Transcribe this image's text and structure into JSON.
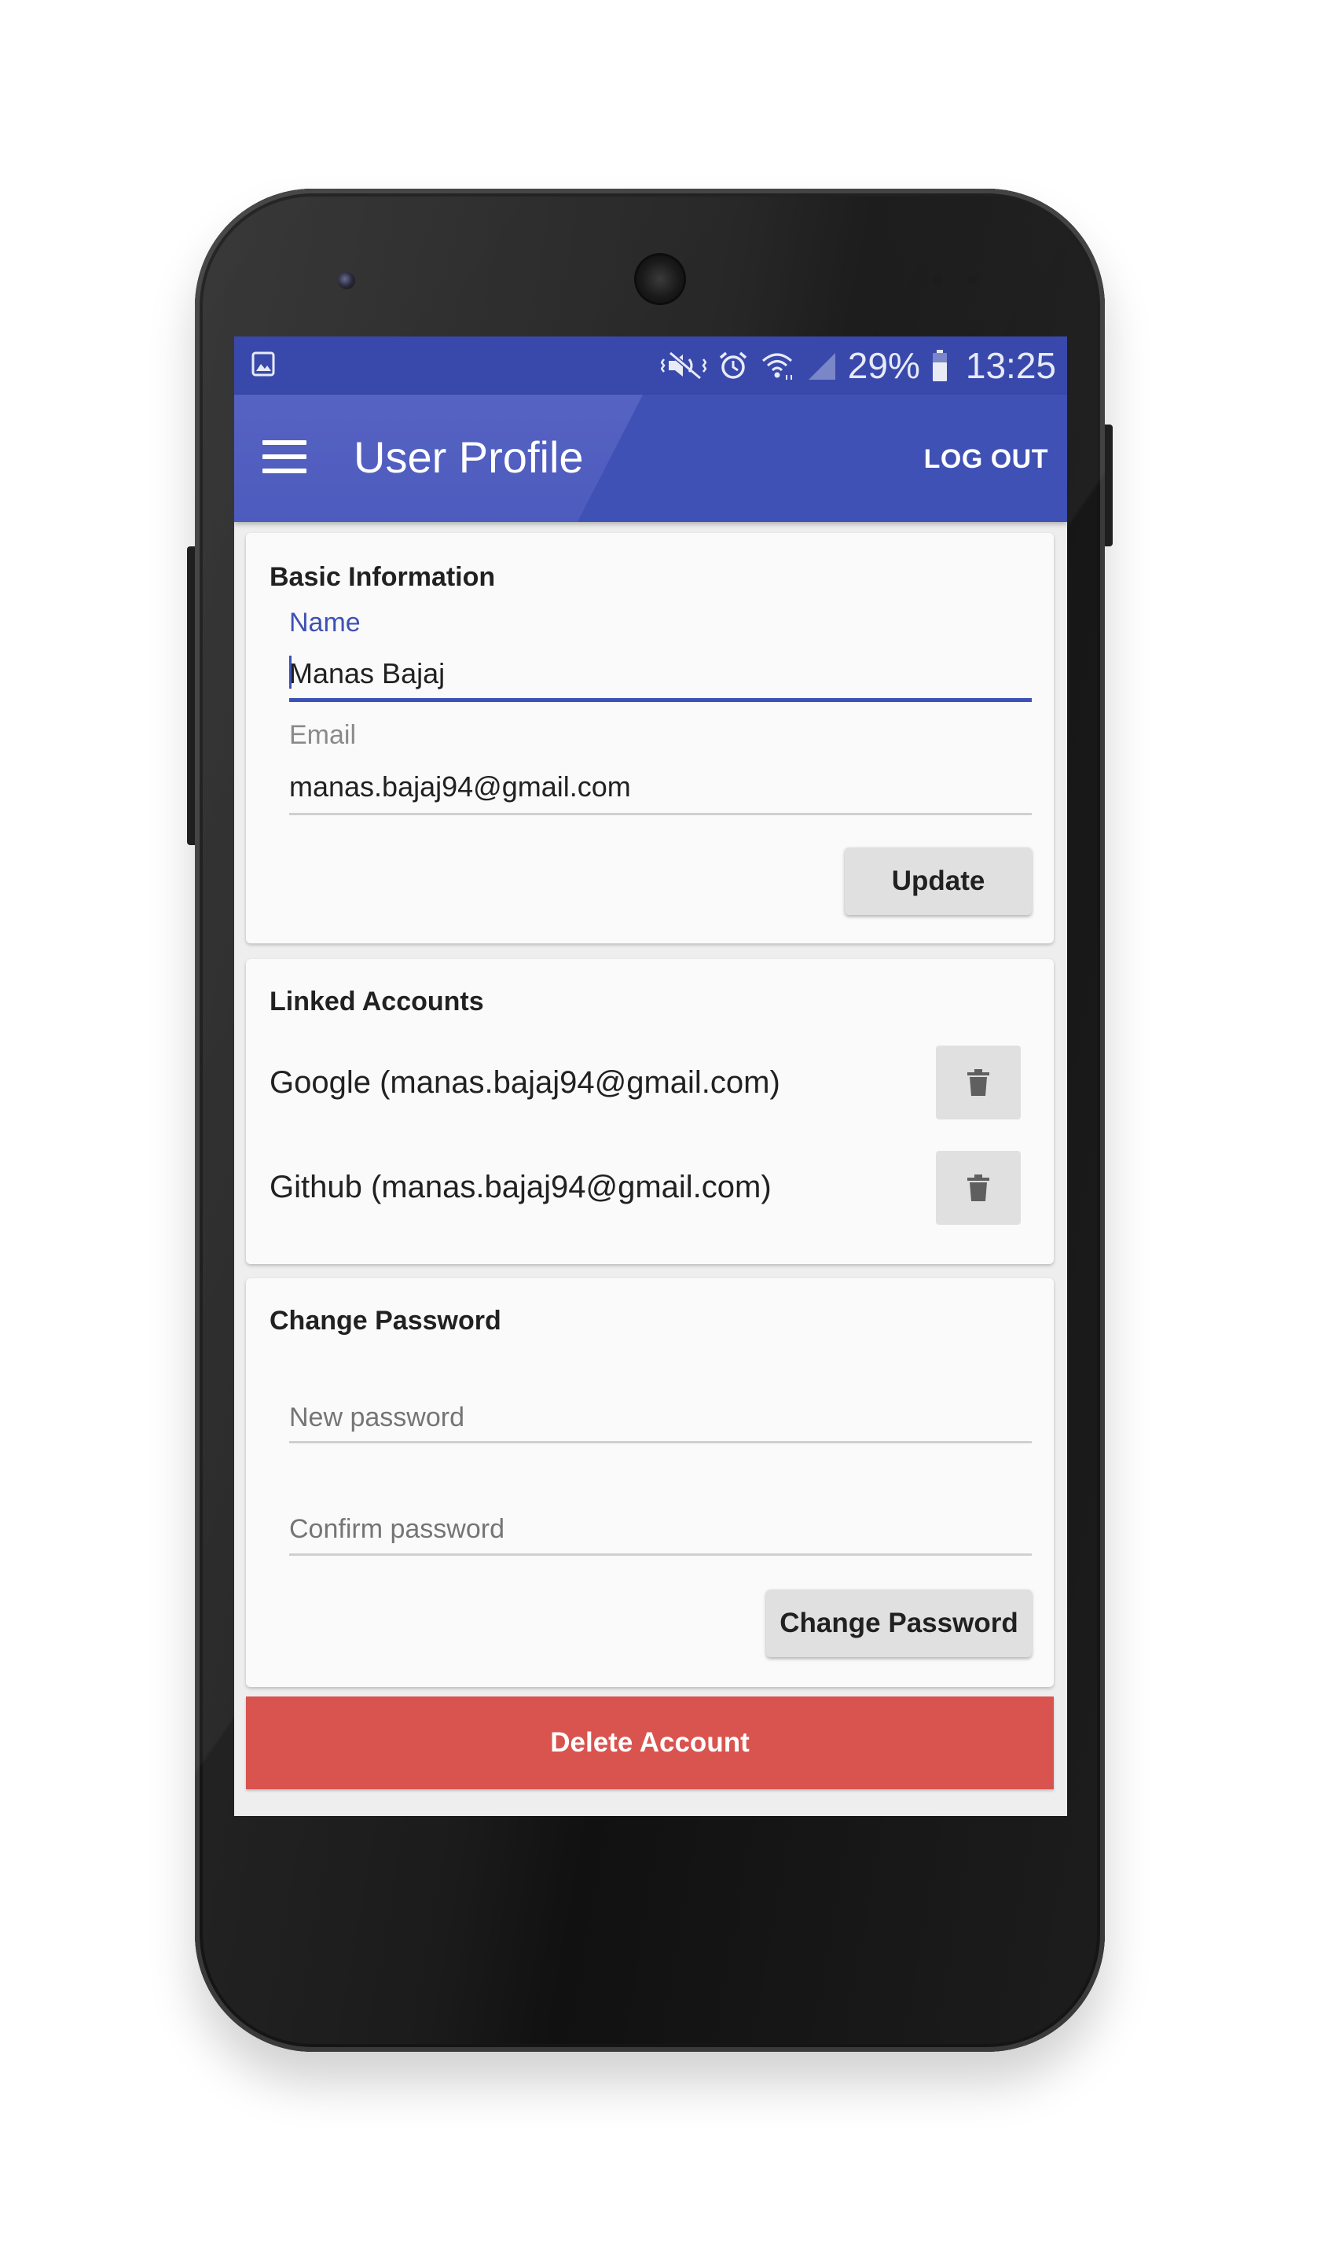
{
  "status_bar": {
    "battery": "29%",
    "time": "13:25",
    "icons": [
      "image-icon",
      "mute-vibrate-icon",
      "alarm-icon",
      "wifi-icon",
      "signal-icon",
      "battery-icon"
    ]
  },
  "app_bar": {
    "title": "User Profile",
    "logout_label": "LOG OUT",
    "color": "#3f51b5",
    "status_color": "#3949ab"
  },
  "basic_info": {
    "title": "Basic Information",
    "name_label": "Name",
    "name_value": "Manas Bajaj",
    "email_label": "Email",
    "email_value": "manas.bajaj94@gmail.com",
    "update_label": "Update"
  },
  "linked_accounts": {
    "title": "Linked Accounts",
    "items": [
      {
        "label": "Google (manas.bajaj94@gmail.com)"
      },
      {
        "label": "Github (manas.bajaj94@gmail.com)"
      }
    ]
  },
  "change_password": {
    "title": "Change Password",
    "new_placeholder": "New password",
    "confirm_placeholder": "Confirm password",
    "button_label": "Change Password"
  },
  "delete_account": {
    "label": "Delete Account",
    "color": "#d9534f"
  }
}
